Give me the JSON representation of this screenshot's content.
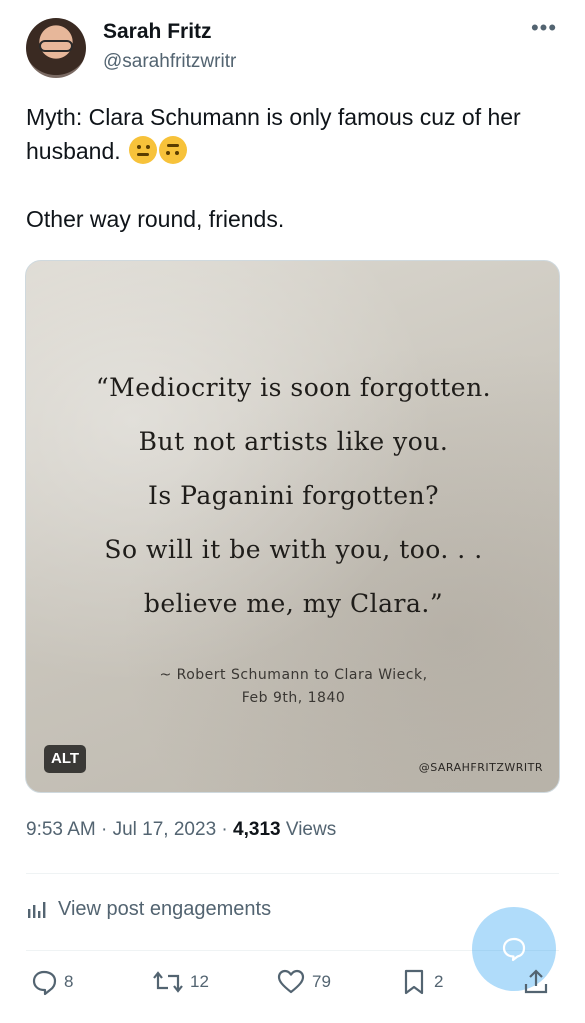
{
  "author": {
    "name": "Sarah Fritz",
    "handle": "@sarahfritzwritr"
  },
  "tweet": {
    "line1": "Myth: Clara Schumann is only famous cuz of her husband.",
    "emojis": [
      "raised-eyebrow-face-emoji",
      "upside-down-face-emoji"
    ],
    "line2": "Other way round, friends."
  },
  "media": {
    "quote_lines": [
      "“Mediocrity is soon forgotten.",
      "But not artists like you.",
      "Is Paganini forgotten?",
      "So will it be with you, too. . .",
      "believe me, my Clara.”"
    ],
    "attribution_lines": [
      "~ Robert Schumann to Clara Wieck,",
      "Feb 9th, 1840"
    ],
    "alt_label": "ALT",
    "watermark": "@SARAHFRITZWRITR"
  },
  "meta": {
    "time": "9:53 AM",
    "date": "Jul 17, 2023",
    "views_count": "4,313",
    "views_label": "Views"
  },
  "engagements_label": "View post engagements",
  "actions": {
    "replies": "8",
    "reposts": "12",
    "likes": "79",
    "bookmarks": "2"
  },
  "colors": {
    "accent": "#1d9bf0",
    "secondary_text": "#536471"
  }
}
